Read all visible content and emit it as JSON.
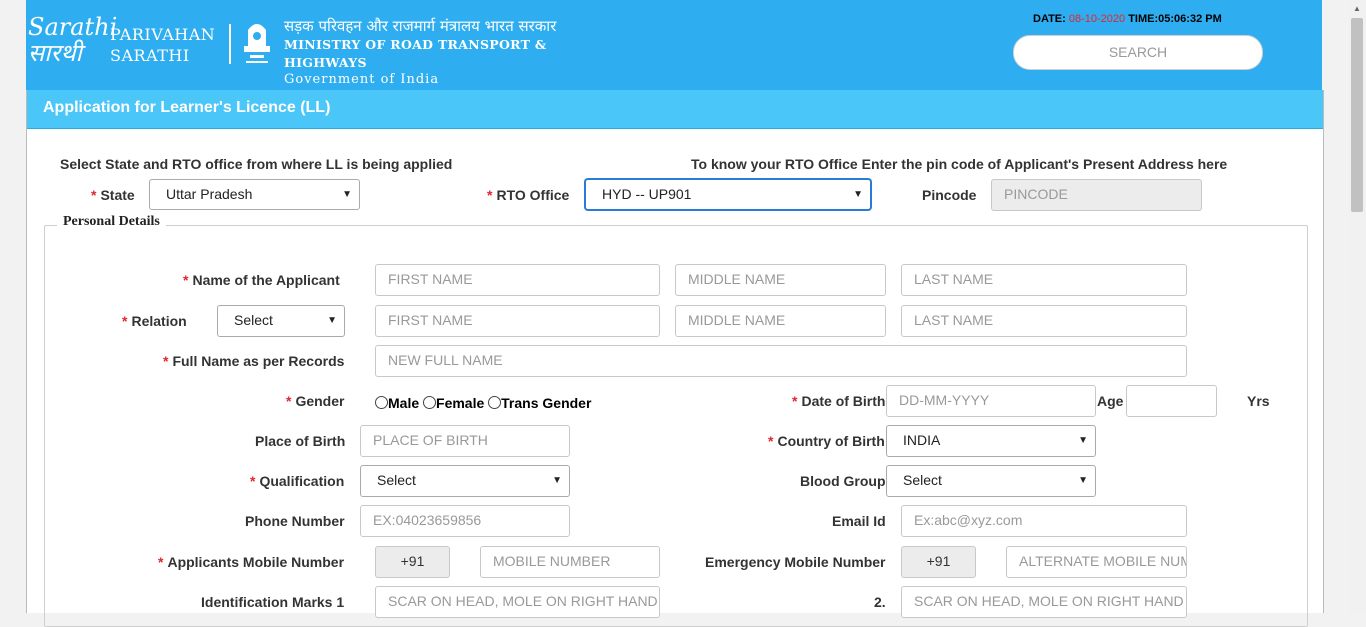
{
  "header": {
    "logo_text": "Sarathi सारथी",
    "brand_line1": "PARIVAHAN",
    "brand_line2": "SARATHI",
    "ministry_hindi": "सड़क परिवहन और राजमार्ग मंत्रालय भारत सरकार",
    "ministry_english": "MINISTRY OF ROAD TRANSPORT & HIGHWAYS",
    "government": "Government of India",
    "date_label": "DATE:",
    "date_value": "08-10-2020",
    "time_label": "TIME:",
    "time_value": "05:06:32 PM",
    "search_placeholder": "SEARCH"
  },
  "page": {
    "title": "Application for Learner's Licence (LL)",
    "select_state_note": "Select State and RTO office from where LL is being applied",
    "pin_note": "To know your RTO Office Enter the pin code of Applicant's Present Address here",
    "state_label": "State",
    "state_value": "Uttar Pradesh",
    "rto_label": "RTO Office",
    "rto_value": "HYD -- UP901",
    "pincode_label": "Pincode",
    "pincode_placeholder": "PINCODE"
  },
  "personal": {
    "legend": "Personal Details",
    "applicant_name_label": "Name of the Applicant",
    "first_name": "FIRST NAME",
    "middle_name": "MIDDLE NAME",
    "last_name": "LAST NAME",
    "relation_label": "Relation",
    "relation_value": "Select",
    "full_name_label": "Full Name as per Records",
    "full_name_placeholder": "NEW FULL NAME",
    "gender_label": "Gender",
    "gender_options": [
      "Male",
      "Female",
      "Trans Gender"
    ],
    "dob_label": "Date of Birth",
    "dob_placeholder": "DD-MM-YYYY",
    "age_label": "Age",
    "yrs_label": "Yrs",
    "place_of_birth_label": "Place of Birth",
    "place_of_birth_placeholder": "PLACE OF BIRTH",
    "country_label": "Country of Birth",
    "country_value": "INDIA",
    "qualification_label": "Qualification",
    "qualification_value": "Select",
    "blood_group_label": "Blood Group",
    "blood_group_value": "Select",
    "phone_label": "Phone Number",
    "phone_placeholder": "EX:04023659856",
    "email_label": "Email Id",
    "email_placeholder": "Ex:abc@xyz.com",
    "mobile_label": "Applicants Mobile Number",
    "country_code": "+91",
    "mobile_placeholder": "MOBILE NUMBER",
    "emergency_label": "Emergency Mobile Number",
    "emergency_placeholder": "ALTERNATE MOBILE NUMBER",
    "id_marks_label": "Identification Marks 1",
    "id_marks_2_label": "2.",
    "id_marks_placeholder": "SCAR ON HEAD, MOLE ON RIGHT HAND"
  }
}
